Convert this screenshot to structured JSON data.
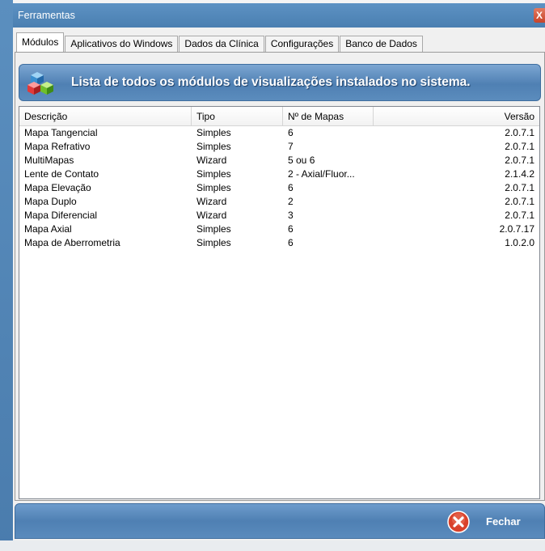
{
  "window": {
    "title": "Ferramentas",
    "close_label": "X"
  },
  "tabs": [
    {
      "label": "Módulos",
      "active": true
    },
    {
      "label": "Aplicativos do Windows"
    },
    {
      "label": "Dados da Clínica"
    },
    {
      "label": "Configurações"
    },
    {
      "label": "Banco de Dados"
    }
  ],
  "banner": {
    "icon": "cubes-icon",
    "text": "Lista de todos os módulos de visualizações instalados no sistema."
  },
  "modules_table": {
    "columns": [
      "Descrição",
      "Tipo",
      "Nº de Mapas",
      "Versão"
    ],
    "rows": [
      [
        "Mapa Tangencial",
        "Simples",
        "6",
        "2.0.7.1"
      ],
      [
        "Mapa Refrativo",
        "Simples",
        "7",
        "2.0.7.1"
      ],
      [
        "MultiMapas",
        "Wizard",
        "5 ou 6",
        "2.0.7.1"
      ],
      [
        "Lente de Contato",
        "Simples",
        "2 - Axial/Fluor...",
        "2.1.4.2"
      ],
      [
        "Mapa Elevação",
        "Simples",
        "6",
        "2.0.7.1"
      ],
      [
        "Mapa Duplo",
        "Wizard",
        "2",
        "2.0.7.1"
      ],
      [
        "Mapa Diferencial",
        "Wizard",
        "3",
        "2.0.7.1"
      ],
      [
        "Mapa Axial",
        "Simples",
        "6",
        "2.0.7.17"
      ],
      [
        "Mapa de Aberrometria",
        "Simples",
        "6",
        "1.0.2.0"
      ]
    ]
  },
  "footer": {
    "close_button_label": "Fechar",
    "close_button_icon": "close-circle-icon"
  },
  "colors": {
    "chrome_blue": "#4f80b3",
    "close_red": "#d9412a"
  }
}
